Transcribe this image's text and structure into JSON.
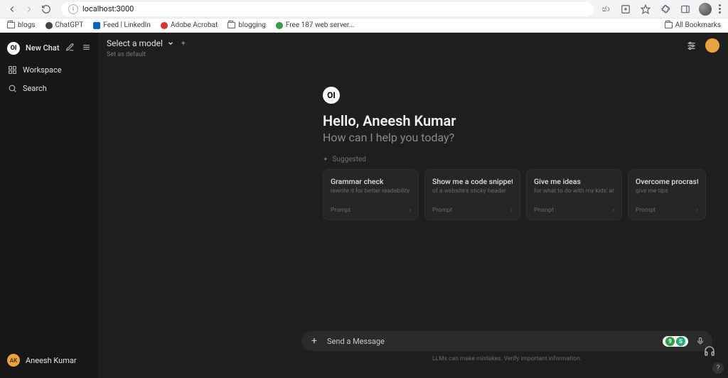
{
  "browser": {
    "url": "localhost:3000",
    "translate_label": "ඡා",
    "actions": {
      "install": "⤓",
      "star": "☆",
      "ext": "✧"
    }
  },
  "bookmarks": {
    "items": [
      {
        "label": "blogs"
      },
      {
        "label": "ChatGPT"
      },
      {
        "label": "Feed | LinkedIn"
      },
      {
        "label": "Adobe Acrobat"
      },
      {
        "label": "blogging"
      },
      {
        "label": "Free 187 web server..."
      }
    ],
    "all": "All Bookmarks"
  },
  "sidebar": {
    "logo": "OI",
    "new_chat": "New Chat",
    "workspace": "Workspace",
    "search": "Search",
    "user_initials": "AK",
    "user_name": "Aneesh Kumar"
  },
  "header": {
    "model_label": "Select a model",
    "set_default": "Set as default"
  },
  "hero": {
    "logo": "OI",
    "greeting": "Hello, Aneesh Kumar",
    "sub": "How can I help you today?",
    "suggested_label": "Suggested"
  },
  "cards": [
    {
      "title": "Grammar check",
      "sub": "rewrite it for better readability",
      "footer": "Prompt"
    },
    {
      "title": "Show me a code snippet",
      "sub": "of a website's sticky header",
      "footer": "Prompt"
    },
    {
      "title": "Give me ideas",
      "sub": "for what to do with my kids' art",
      "footer": "Prompt"
    },
    {
      "title": "Overcome procrastination",
      "sub": "give me tips",
      "footer": "Prompt"
    }
  ],
  "composer": {
    "placeholder": "Send a Message",
    "badge1": "9",
    "badge2": "S"
  },
  "footer": {
    "disclaimer": "LLMs can make mistakes. Verify important information."
  },
  "help": {
    "q": "?"
  }
}
